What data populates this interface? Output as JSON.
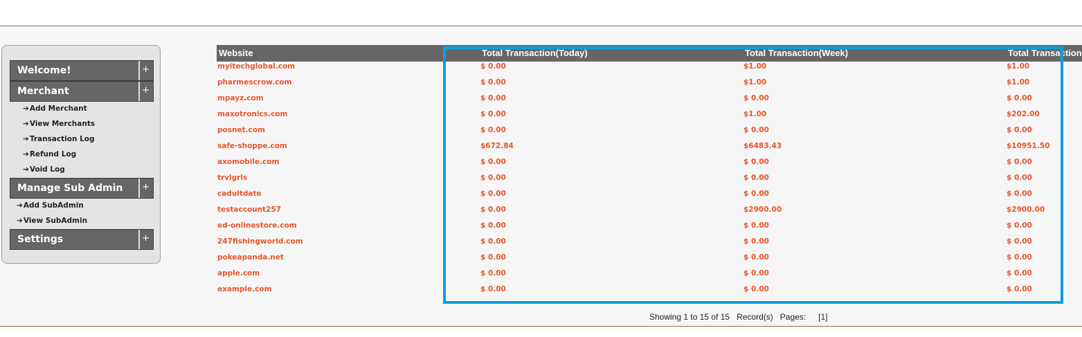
{
  "sidebar": {
    "welcome": "Welcome!",
    "merchant": "Merchant",
    "merchant_items": [
      "Add Merchant",
      "View Merchants",
      "Transaction Log",
      "Refund Log",
      "Void Log"
    ],
    "manage_sub_admin": "Manage Sub Admin",
    "sub_admin_items": [
      "Add SubAdmin",
      "View SubAdmin"
    ],
    "settings": "Settings",
    "plus": "+",
    "arrow": "➔"
  },
  "table": {
    "columns": [
      "Website",
      "Total Transaction(Today)",
      "Total Transaction(Week)",
      "Total Transaction(Month)"
    ],
    "rows": [
      [
        "myitechglobal.com",
        "$ 0.00",
        "$1.00",
        "$1.00"
      ],
      [
        "pharmescrow.com",
        "$ 0.00",
        "$1.00",
        "$1.00"
      ],
      [
        "mpayz.com",
        "$ 0.00",
        "$ 0.00",
        "$ 0.00"
      ],
      [
        "maxotronics.com",
        "$ 0.00",
        "$1.00",
        "$202.00"
      ],
      [
        "posnet.com",
        "$ 0.00",
        "$ 0.00",
        "$ 0.00"
      ],
      [
        "safe-shoppe.com",
        "$672.84",
        "$6483.43",
        "$10951.50"
      ],
      [
        "axomobile.com",
        "$ 0.00",
        "$ 0.00",
        "$ 0.00"
      ],
      [
        "trvlgrls",
        "$ 0.00",
        "$ 0.00",
        "$ 0.00"
      ],
      [
        "cadultdate",
        "$ 0.00",
        "$ 0.00",
        "$ 0.00"
      ],
      [
        "testaccount257",
        "$ 0.00",
        "$2900.00",
        "$2900.00"
      ],
      [
        "ed-onlinestore.com",
        "$ 0.00",
        "$ 0.00",
        "$ 0.00"
      ],
      [
        "247fishingworld.com",
        "$ 0.00",
        "$ 0.00",
        "$ 0.00"
      ],
      [
        "pokeapanda.net",
        "$ 0.00",
        "$ 0.00",
        "$ 0.00"
      ],
      [
        "apple.com",
        "$ 0.00",
        "$ 0.00",
        "$ 0.00"
      ],
      [
        "example.com",
        "$ 0.00",
        "$ 0.00",
        "$ 0.00"
      ]
    ]
  },
  "pager": {
    "showing": "Showing 1 to 15 of 15",
    "records": "Record(s)",
    "pages_label": "Pages:",
    "current_page": "[1]"
  },
  "colors": {
    "header_bg": "#666666",
    "link": "#e8562a",
    "highlight": "#0e9fde"
  }
}
